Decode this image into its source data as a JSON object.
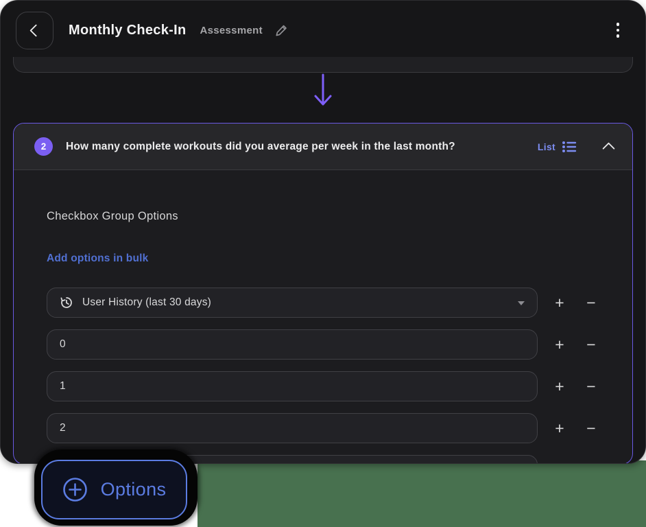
{
  "colors": {
    "purple": "#7b5ff2",
    "purple_border": "#6a5ae4",
    "list_accent": "#7c8cf0",
    "link_blue": "#5170d2",
    "options_blue": "#5b7ce2",
    "backdrop_green": "#48714f"
  },
  "header": {
    "title": "Monthly Check-In",
    "subtitle": "Assessment"
  },
  "question": {
    "number": "2",
    "text": "How many complete workouts did you average per week in the last month?",
    "type_label": "List"
  },
  "options_panel": {
    "section_title": "Checkbox Group Options",
    "bulk_add_label": "Add options in bulk",
    "rows": [
      {
        "value": "User History (last 30 days)"
      },
      {
        "value": "0"
      },
      {
        "value": "1"
      },
      {
        "value": "2"
      }
    ],
    "increment_label": "+",
    "decrement_label": "−"
  },
  "options_button": {
    "label": "Options"
  }
}
